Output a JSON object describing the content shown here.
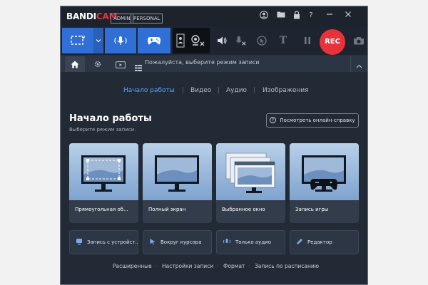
{
  "app": {
    "logo_a": "BANDI",
    "logo_b": "CAM",
    "tag_admin": "ADMIN",
    "tag_personal": "PERSONAL"
  },
  "titlebar_icons": [
    "user-icon",
    "folder-icon",
    "lock-icon",
    "help-icon",
    "minimize-icon",
    "close-icon"
  ],
  "toolbar": {
    "rec_label": "REC",
    "icons": [
      "rectangle-mode-icon",
      "dropdown-chevron-icon",
      "audio-mode-icon",
      "gamepad-icon",
      "webcam-person-icon",
      "webcam-off-icon",
      "speaker-icon",
      "mic-off-icon",
      "cursor-effect-icon",
      "text-icon",
      "pause-icon",
      "camera-icon"
    ]
  },
  "tabs": {
    "hint": "Пожалуйста, выберите режим записи"
  },
  "subtabs": [
    "Начало работы",
    "Видео",
    "Аудио",
    "Изображения"
  ],
  "main": {
    "title": "Начало работы",
    "subtitle": "Выберите режим записи.",
    "help_button": "Посмотреть онлайн-справку"
  },
  "cards": [
    {
      "label": "Прямоугольная об..."
    },
    {
      "label": "Полный экран"
    },
    {
      "label": "Выбранное окно"
    },
    {
      "label": "Запись игры"
    }
  ],
  "small_buttons": [
    {
      "label": "Запись с устройст..."
    },
    {
      "label": "Вокруг курсора"
    },
    {
      "label": "Только аудио"
    },
    {
      "label": "Редактор"
    }
  ],
  "footer_links": [
    "Расширенные",
    "Настройки записи",
    "Формат",
    "Запись по расписанию"
  ],
  "colors": {
    "accent": "#2f6fd6",
    "rec": "#e8323b",
    "active_tab": "#5aa3ff"
  }
}
